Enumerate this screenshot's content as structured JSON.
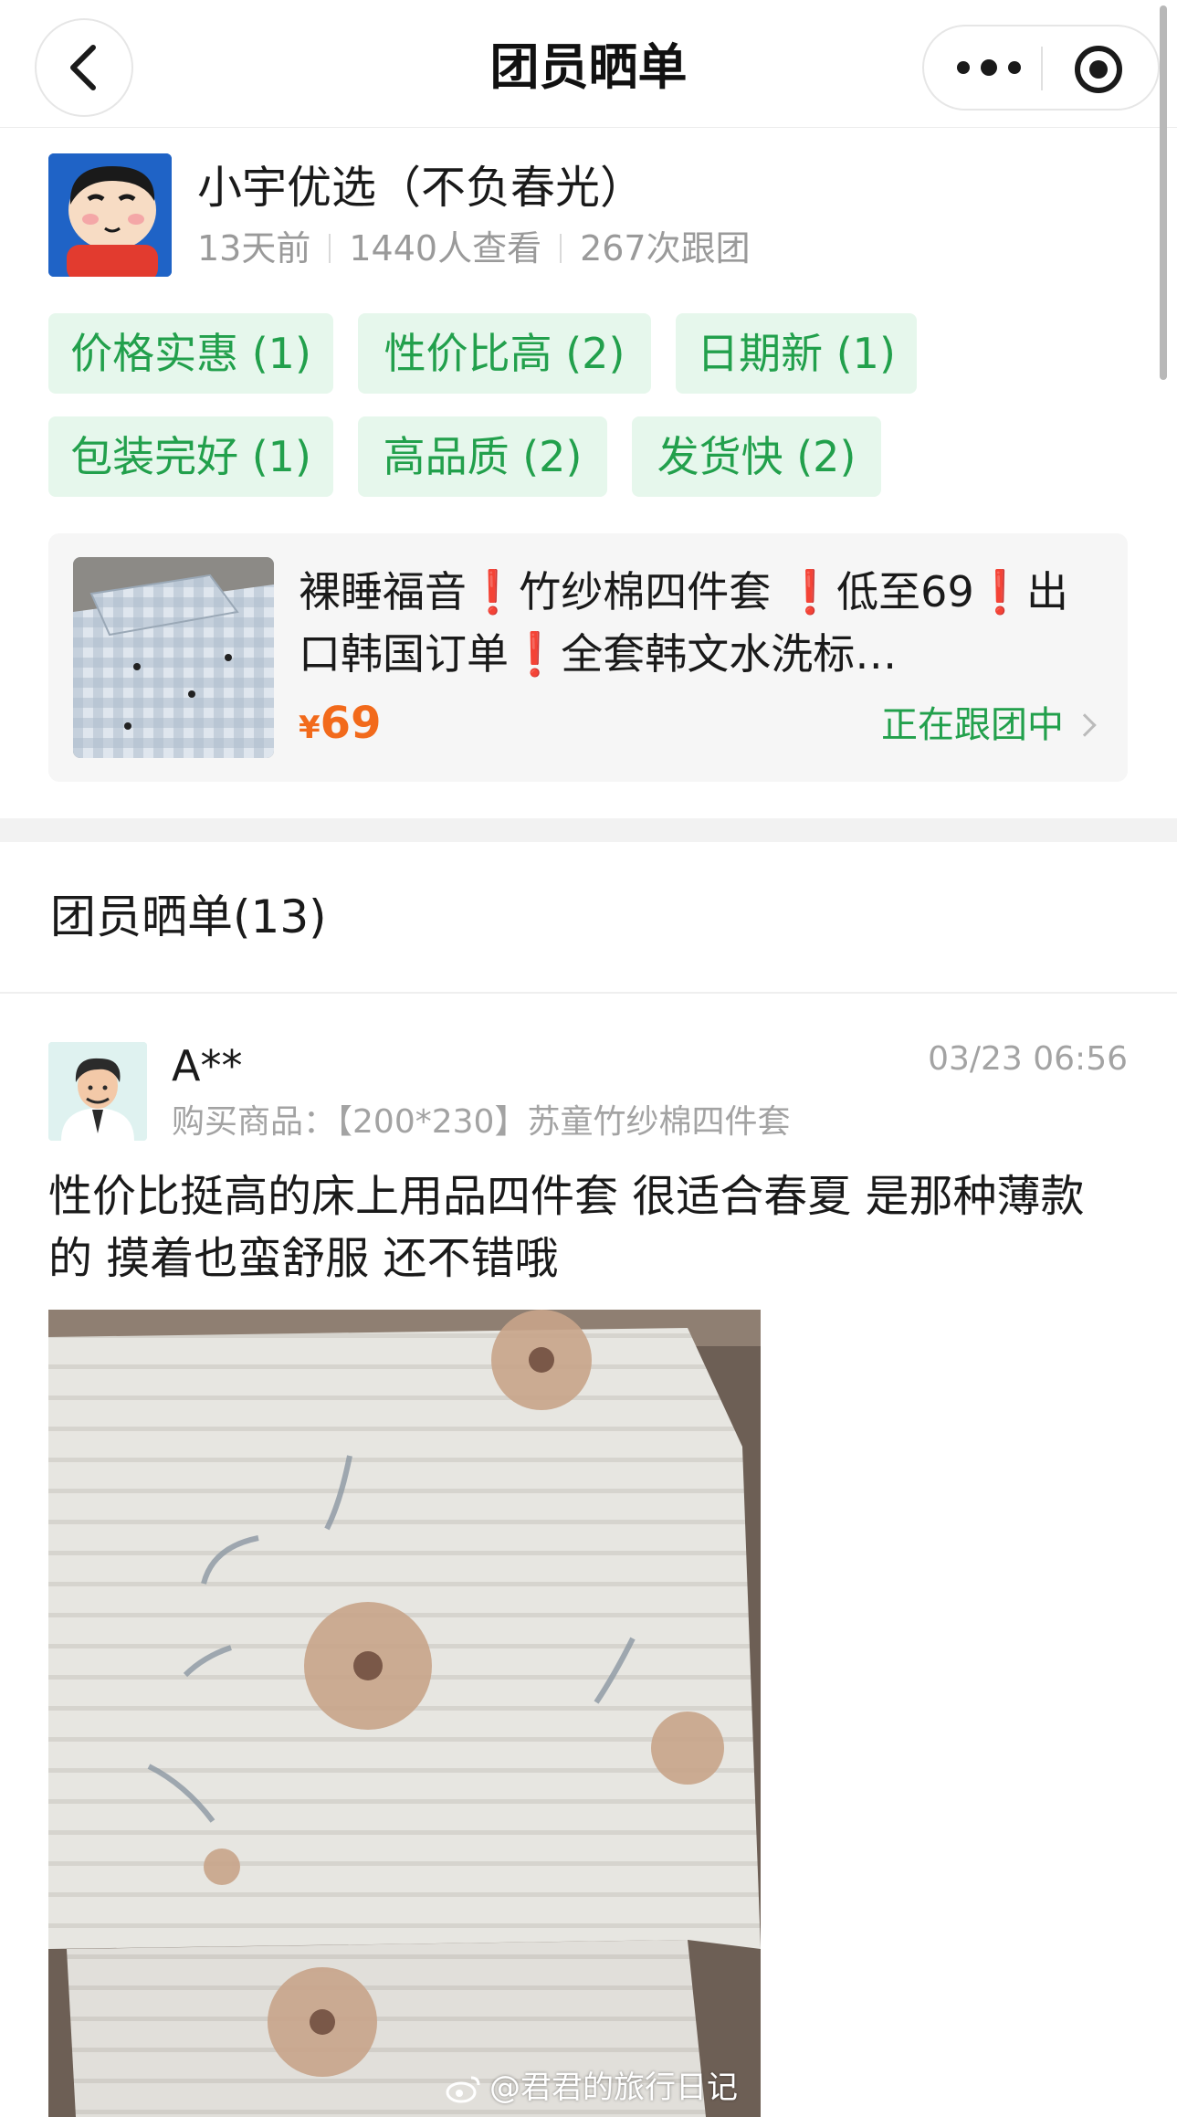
{
  "navbar": {
    "title": "团员晒单",
    "back_icon": "chevron-left-icon",
    "more_icon": "more-dots-icon",
    "close_icon": "target-circle-icon"
  },
  "group": {
    "name": "小宇优选（不负春光）",
    "time_ago": "13天前",
    "views": "1440人查看",
    "joins": "267次跟团"
  },
  "tags": [
    {
      "label": "价格实惠 (1)"
    },
    {
      "label": "性价比高 (2)"
    },
    {
      "label": "日期新 (1)"
    },
    {
      "label": "包装完好 (1)"
    },
    {
      "label": "高品质 (2)"
    },
    {
      "label": "发货快 (2)"
    }
  ],
  "product": {
    "title": "裸睡福音❗️竹纱棉四件套 ❗️低至69❗️出口韩国订单❗️全套韩文水洗标…",
    "price_symbol": "¥",
    "price": "69",
    "status": "正在跟团中"
  },
  "section": {
    "title": "团员晒单(13)"
  },
  "review": {
    "user": "A**",
    "time": "03/23 06:56",
    "product_label": "购买商品：",
    "product_name": "【200*230】苏童竹纱棉四件套",
    "text": "性价比挺高的床上用品四件套 很适合春夏 是那种薄款的 摸着也蛮舒服 还不错哦",
    "watermark": "@君君的旅行日记"
  },
  "colors": {
    "accent_green": "#22a04c",
    "tag_bg": "#e6f7ec",
    "price_orange": "#f26a1b",
    "meta_gray": "#9a9a9a"
  }
}
